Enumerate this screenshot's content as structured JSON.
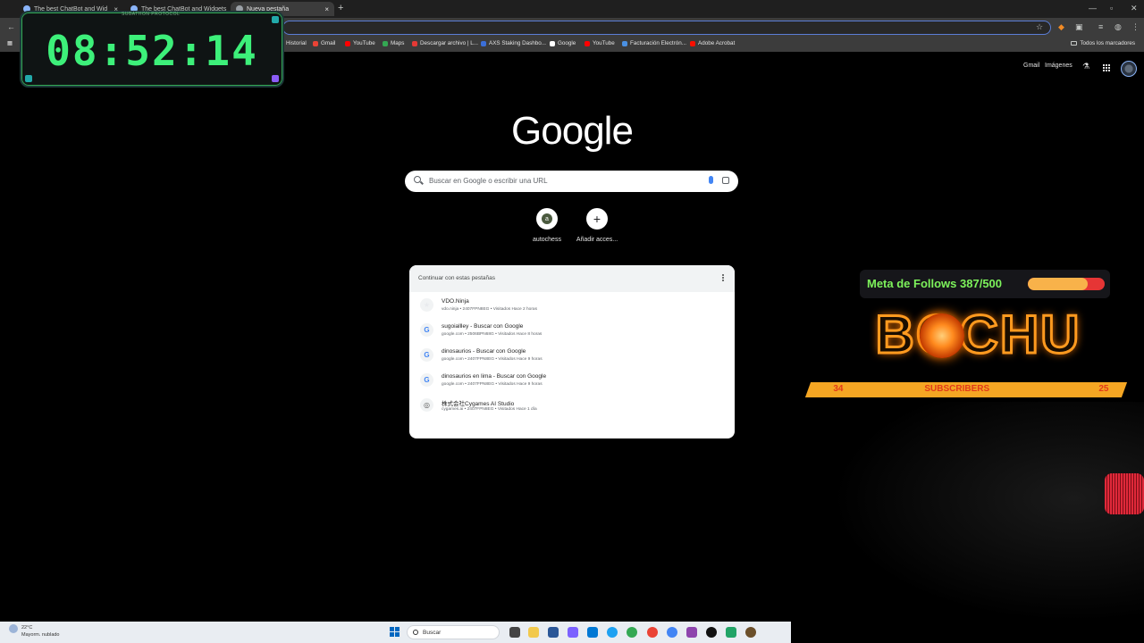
{
  "browser": {
    "tabs": [
      {
        "title": "The best ChatBot and Wid"
      },
      {
        "title": "The best ChatBot and Widgets"
      },
      {
        "title": "Nueva pestaña"
      }
    ],
    "bookmarks": [
      "Historial",
      "Gmail",
      "YouTube",
      "Maps",
      "Descargar archivo | L...",
      "AXS Staking Dashbo...",
      "Google",
      "YouTube",
      "Facturación Electrón...",
      "Adobe Acrobat"
    ],
    "all_bookmarks": "Todos los marcadores"
  },
  "google": {
    "links": {
      "gmail": "Gmail",
      "images": "Imágenes"
    },
    "logo": "Google",
    "search_placeholder": "Buscar en Google o escribir una URL",
    "shortcuts": [
      {
        "label": "autochess",
        "icon": "a"
      },
      {
        "label": "Añadir acces...",
        "icon": "+"
      }
    ],
    "continue_card": {
      "title": "Continuar con estas pestañas",
      "items": [
        {
          "title": "VDO.Ninja",
          "subtitle": "vdo.ninja • 2407FPN8EG • Visitados Hace 2 horas",
          "icon": "★"
        },
        {
          "title": "sugoiallley - Buscar con Google",
          "subtitle": "google.com • 2506BPN68G • Visitados Hace 8 horas",
          "icon": "G"
        },
        {
          "title": "dinosaurios - Buscar con Google",
          "subtitle": "google.com • 2407FPN8EG • Visitados Hace 9 horas",
          "icon": "G"
        },
        {
          "title": "dinosaurios en lima - Buscar con Google",
          "subtitle": "google.com • 2407FPN8EG • Visitados Hace 9 horas",
          "icon": "G"
        },
        {
          "title": "株式会社Cygames AI Studio",
          "subtitle": "cygames.ai • 2407FPN8EG • Visitados Hace 1 día",
          "icon": "◎"
        }
      ]
    }
  },
  "overlay": {
    "timer_label": "SUBATHON PROTOCOL",
    "timer": "08:52:14",
    "follows_text": "Meta de Follows 387/500",
    "follows_progress": 0.774,
    "brand": "BOCHU",
    "subs_left": "34",
    "subs_label": "SUBSCRIBERS",
    "subs_right": "25"
  },
  "taskbar": {
    "temp": "22°C",
    "weather": "Mayorm. nublado",
    "search": "Buscar"
  }
}
